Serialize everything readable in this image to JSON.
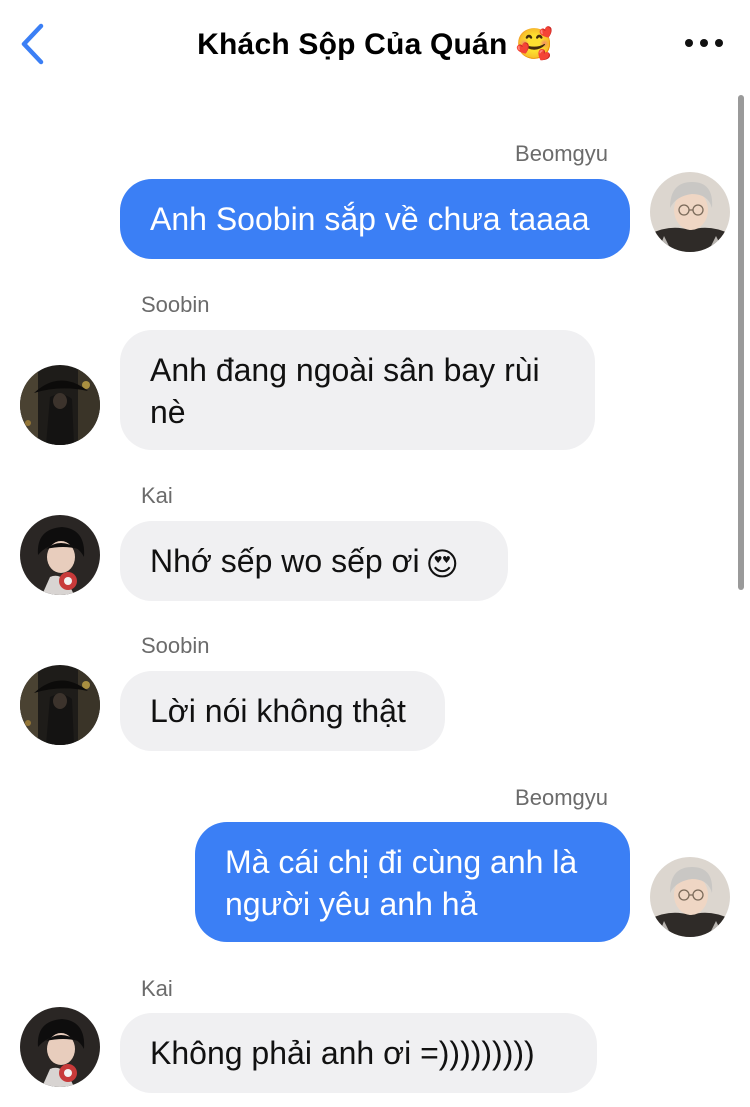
{
  "header": {
    "title": "Khách Sộp Của Quán",
    "title_emoji": "🥰",
    "accent_color": "#3b7ff5"
  },
  "messages": [
    {
      "sender": "Beomgyu",
      "text": "Anh Soobin sắp về chưa taaaa",
      "direction": "outgoing"
    },
    {
      "sender": "Soobin",
      "text": "Anh đang ngoài sân bay rùi nè",
      "direction": "incoming"
    },
    {
      "sender": "Kai",
      "text": "Nhớ sếp wo sếp ơi",
      "emoji": "😍",
      "direction": "incoming"
    },
    {
      "sender": "Soobin",
      "text": "Lời nói không thật",
      "direction": "incoming"
    },
    {
      "sender": "Beomgyu",
      "text": "Mà cái chị đi cùng anh là người yêu anh hả",
      "direction": "outgoing"
    },
    {
      "sender": "Kai",
      "text": "Không phải anh ơi =)))))))))",
      "direction": "incoming"
    }
  ],
  "colors": {
    "outgoing_bubble": "#3b7ff5",
    "incoming_bubble": "#f0f0f2",
    "sender_name": "#6b6b6b"
  }
}
